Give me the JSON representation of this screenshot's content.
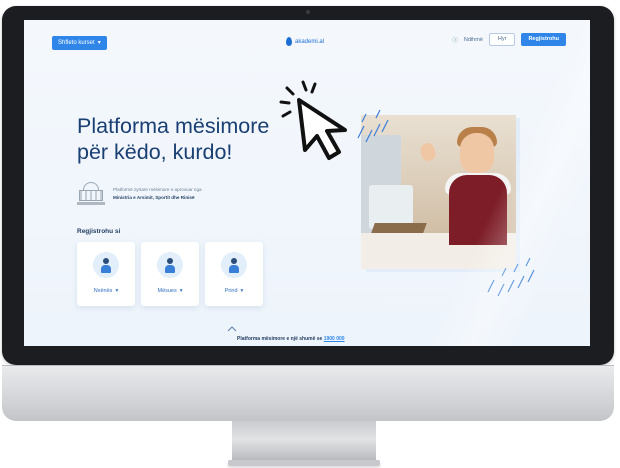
{
  "nav": {
    "courses_button": "Shfleto kurset",
    "logo_text": "akademi.al",
    "help_link": "Ndihmë",
    "login_button": "Hyr",
    "register_button": "Regjistrohu"
  },
  "hero": {
    "title_line1": "Platforma mësimore",
    "title_line2": "për këdo, kurdo!",
    "partner_line1": "Platformë zyrtare mësimore e aprovuar nga",
    "partner_line2": "Ministria e Arsimit, Sportit dhe Rinisë"
  },
  "register": {
    "label": "Regjistrohu si",
    "cards": [
      {
        "label": "Nxënës",
        "icon": "student-icon"
      },
      {
        "label": "Mësues",
        "icon": "teacher-icon"
      },
      {
        "label": "Prind",
        "icon": "parent-icon"
      }
    ]
  },
  "footer": {
    "note": "Platforma mësimore e një shumë se",
    "link": "1900 000"
  },
  "colors": {
    "accent": "#2f86e8",
    "heading": "#193f73",
    "screen_bg": "#f4f8fd",
    "bezel": "#1c1d20"
  }
}
